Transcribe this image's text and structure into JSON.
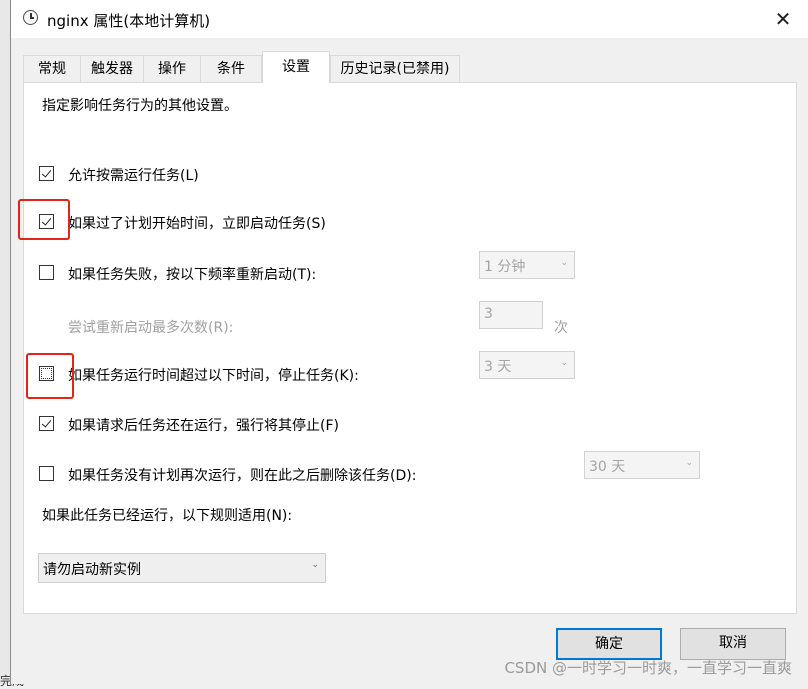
{
  "window": {
    "title": "nginx 属性(本地计算机)",
    "close_glyph": "✕"
  },
  "tabs": [
    {
      "label": "常规"
    },
    {
      "label": "触发器"
    },
    {
      "label": "操作"
    },
    {
      "label": "条件"
    },
    {
      "label": "设置"
    },
    {
      "label": "历史记录(已禁用)"
    }
  ],
  "settings": {
    "description": "指定影响任务行为的其他设置。",
    "allow_on_demand": {
      "label": "允许按需运行任务(L)",
      "checked": true
    },
    "run_asap": {
      "label": "如果过了计划开始时间，立即启动任务(S)",
      "checked": true
    },
    "restart_on_fail": {
      "label": "如果任务失败，按以下频率重新启动(T):",
      "checked": false,
      "interval": "1 分钟"
    },
    "retry_count": {
      "label": "尝试重新启动最多次数(R):",
      "value": "3",
      "unit": "次"
    },
    "stop_if_longer": {
      "label": "如果任务运行时间超过以下时间，停止任务(K):",
      "checked": false,
      "duration": "3 天"
    },
    "force_stop": {
      "label": "如果请求后任务还在运行，强行将其停止(F)",
      "checked": true
    },
    "delete_if_not_scheduled": {
      "label": "如果任务没有计划再次运行，则在此之后删除该任务(D):",
      "checked": false,
      "after": "30 天"
    },
    "running_rule": {
      "label": "如果此任务已经运行，以下规则适用(N):",
      "value": "请勿启动新实例"
    }
  },
  "buttons": {
    "ok": "确定",
    "cancel": "取消"
  },
  "watermark": "CSDN @一时学习一时爽，一直学习一直爽",
  "background_fragment": "完成",
  "colors": {
    "highlight_box": "#e1251b",
    "default_button_border": "#0078d7"
  }
}
